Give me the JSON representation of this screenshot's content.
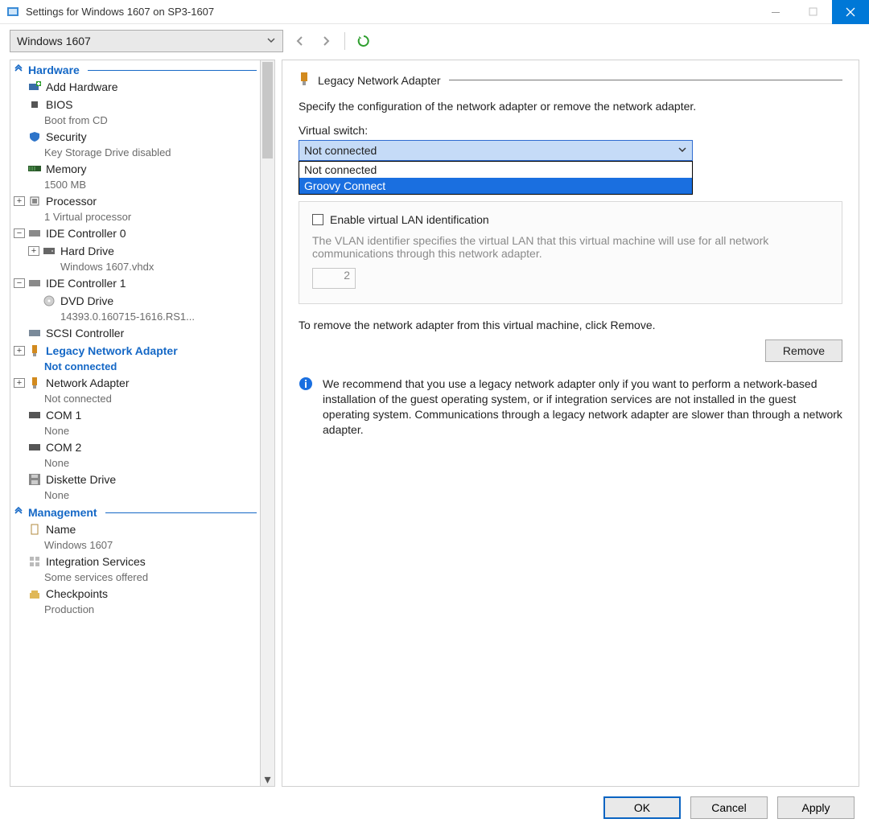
{
  "window": {
    "title": "Settings for Windows 1607 on SP3-1607"
  },
  "toolbar": {
    "vm_name": "Windows 1607"
  },
  "sidebar": {
    "sections": {
      "hardware": "Hardware",
      "management": "Management"
    },
    "items": {
      "add_hw": "Add Hardware",
      "bios": "BIOS",
      "bios_sub": "Boot from CD",
      "security": "Security",
      "security_sub": "Key Storage Drive disabled",
      "memory": "Memory",
      "memory_sub": "1500 MB",
      "processor": "Processor",
      "processor_sub": "1 Virtual processor",
      "ide0": "IDE Controller 0",
      "hdd": "Hard Drive",
      "hdd_sub": "Windows 1607.vhdx",
      "ide1": "IDE Controller 1",
      "dvd": "DVD Drive",
      "dvd_sub": "14393.0.160715-1616.RS1...",
      "scsi": "SCSI Controller",
      "legacy_na": "Legacy Network Adapter",
      "legacy_na_sub": "Not connected",
      "na": "Network Adapter",
      "na_sub": "Not connected",
      "com1": "COM 1",
      "com1_sub": "None",
      "com2": "COM 2",
      "com2_sub": "None",
      "diskette": "Diskette Drive",
      "diskette_sub": "None",
      "name_item": "Name",
      "name_sub": "Windows 1607",
      "integ": "Integration Services",
      "integ_sub": "Some services offered",
      "checkpoints": "Checkpoints",
      "checkpoints_sub": "Production"
    }
  },
  "content": {
    "header": "Legacy Network Adapter",
    "desc": "Specify the configuration of the network adapter or remove the network adapter.",
    "vs_label": "Virtual switch:",
    "vs_value": "Not connected",
    "dropdown": {
      "opt0": "Not connected",
      "opt1": "Groovy Connect"
    },
    "vlan_chk": "Enable virtual LAN identification",
    "vlan_desc": "The VLAN identifier specifies the virtual LAN that this virtual machine will use for all network communications through this network adapter.",
    "vlan_value": "2",
    "remove_text": "To remove the network adapter from this virtual machine, click Remove.",
    "remove_btn": "Remove",
    "info_text": "We recommend that you use a legacy network adapter only if you want to perform a network-based installation of the guest operating system, or if integration services are not installed in the guest operating system. Communications through a legacy network adapter are slower than through a network adapter."
  },
  "footer": {
    "ok": "OK",
    "cancel": "Cancel",
    "apply": "Apply"
  }
}
